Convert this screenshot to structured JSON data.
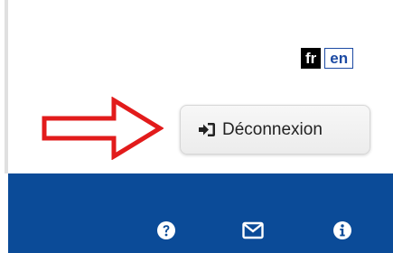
{
  "language_switch": {
    "fr_label": "fr",
    "en_label": "en",
    "active": "en"
  },
  "logout_button": {
    "label": "Déconnexion",
    "icon": "sign-out-icon"
  },
  "annotation": {
    "icon": "red-outline-arrow"
  },
  "navbar": {
    "background": "#0b4b98",
    "icons": [
      "help-icon",
      "mail-icon",
      "info-icon"
    ]
  },
  "colors": {
    "annotation_arrow": "#e21b1b",
    "link_blue": "#1c4aa3"
  }
}
